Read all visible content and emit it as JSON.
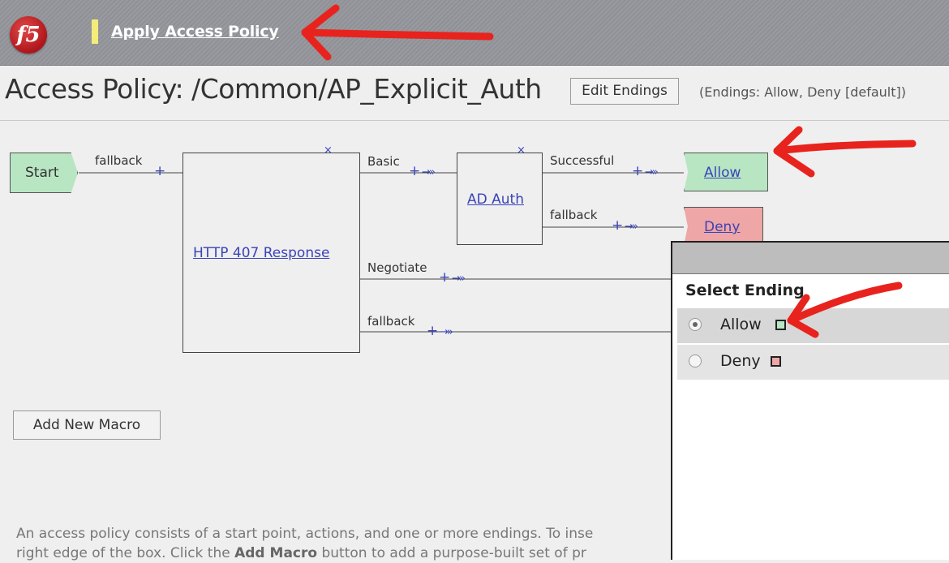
{
  "header": {
    "logo_text": "f5",
    "apply_link": "Apply Access Policy"
  },
  "page": {
    "title": "Access Policy: /Common/AP_Explicit_Auth",
    "edit_endings_button": "Edit Endings",
    "endings_info": "(Endings: Allow, Deny [default])"
  },
  "flow": {
    "start": "Start",
    "start_branch": "fallback",
    "http_action": "HTTP 407 Response",
    "http_branches": [
      "Basic",
      "Negotiate",
      "fallback"
    ],
    "ad_action": "AD Auth",
    "ad_branches": [
      "Successful",
      "fallback"
    ],
    "allow_ending": "Allow",
    "deny_ending": "Deny",
    "plus": "+",
    "arrow": "→»",
    "remove": "×"
  },
  "add_macro_button": "Add New Macro",
  "help": {
    "line1": "An access policy consists of a start point, actions, and one or more endings. To inse",
    "line2_pre": "right edge of the box. Click the ",
    "line2_bold": "Add Macro",
    "line2_post": " button to add a purpose-built set of pr"
  },
  "popup": {
    "heading": "Select Ending",
    "options": [
      {
        "label": "Allow",
        "color": "#b8e6c3",
        "selected": true
      },
      {
        "label": "Deny",
        "color": "#eea6a6",
        "selected": false
      }
    ]
  },
  "colors": {
    "accent_link": "#3a43b8",
    "annotation": "#e8231e"
  }
}
